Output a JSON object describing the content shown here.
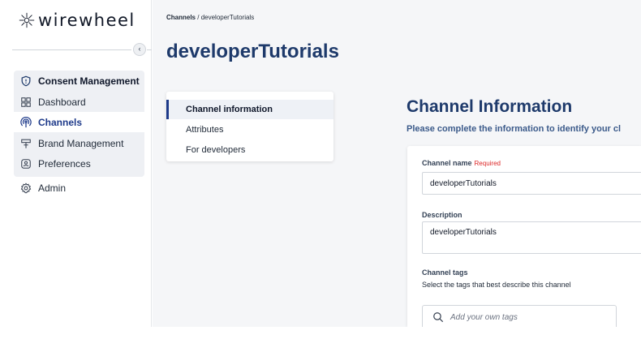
{
  "app": {
    "logo_text": "wirewheel"
  },
  "sidebar": {
    "collapse_glyph": "‹",
    "items": [
      {
        "label": "Consent Management",
        "icon": "shield-icon"
      },
      {
        "label": "Dashboard",
        "icon": "grid-icon"
      },
      {
        "label": "Channels",
        "icon": "broadcast-icon",
        "active": true
      },
      {
        "label": "Brand Management",
        "icon": "sign-icon"
      },
      {
        "label": "Preferences",
        "icon": "user-badge-icon"
      },
      {
        "label": "Admin",
        "icon": "gear-icon"
      }
    ]
  },
  "breadcrumb": {
    "parent": "Channels",
    "separator": " / ",
    "current": "developerTutorials"
  },
  "page": {
    "title": "developerTutorials"
  },
  "tabs": [
    {
      "label": "Channel information",
      "active": true
    },
    {
      "label": "Attributes"
    },
    {
      "label": "For developers"
    }
  ],
  "section": {
    "title": "Channel Information",
    "subtitle": "Please complete the information to identify your cl"
  },
  "form": {
    "channel_name": {
      "label": "Channel name",
      "required_text": "Required",
      "value": "developerTutorials"
    },
    "description": {
      "label": "Description",
      "value": "developerTutorials"
    },
    "tags": {
      "label": "Channel tags",
      "helper": "Select the tags that best describe this channel",
      "placeholder": "Add your own tags"
    }
  },
  "colors": {
    "accent": "#1e3a6b",
    "active_nav": "#1e3a8a",
    "required": "#dc2626"
  }
}
